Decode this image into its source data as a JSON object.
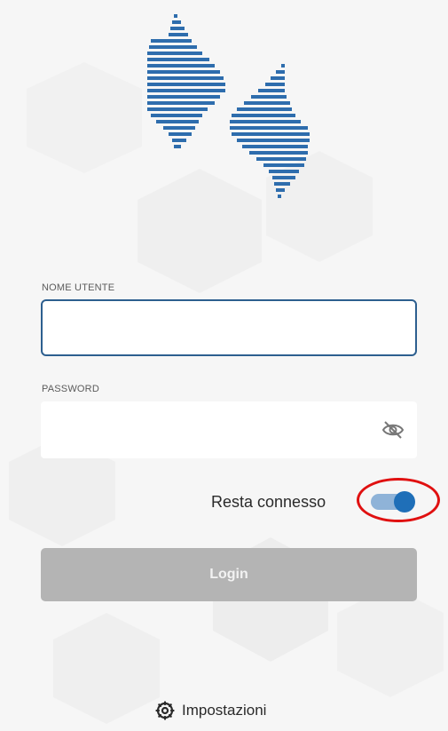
{
  "form": {
    "username": {
      "label": "NOME UTENTE",
      "value": "",
      "placeholder": ""
    },
    "password": {
      "label": "PASSWORD",
      "value": "",
      "placeholder": ""
    },
    "remember": {
      "label": "Resta connesso",
      "checked": true
    },
    "login_label": "Login"
  },
  "footer": {
    "settings_label": "Impostazioni"
  },
  "icons": {
    "logo": "lightning-logo",
    "eye": "eye-slash-icon",
    "settings": "gear-icon"
  },
  "colors": {
    "logo_blue": "#2e6dad",
    "field_border": "#2d5f8f",
    "toggle_track": "#8fb3d8",
    "toggle_knob": "#1f6fb8",
    "login_disabled": "#b4b4b4",
    "annotation_circle": "#e01010"
  }
}
